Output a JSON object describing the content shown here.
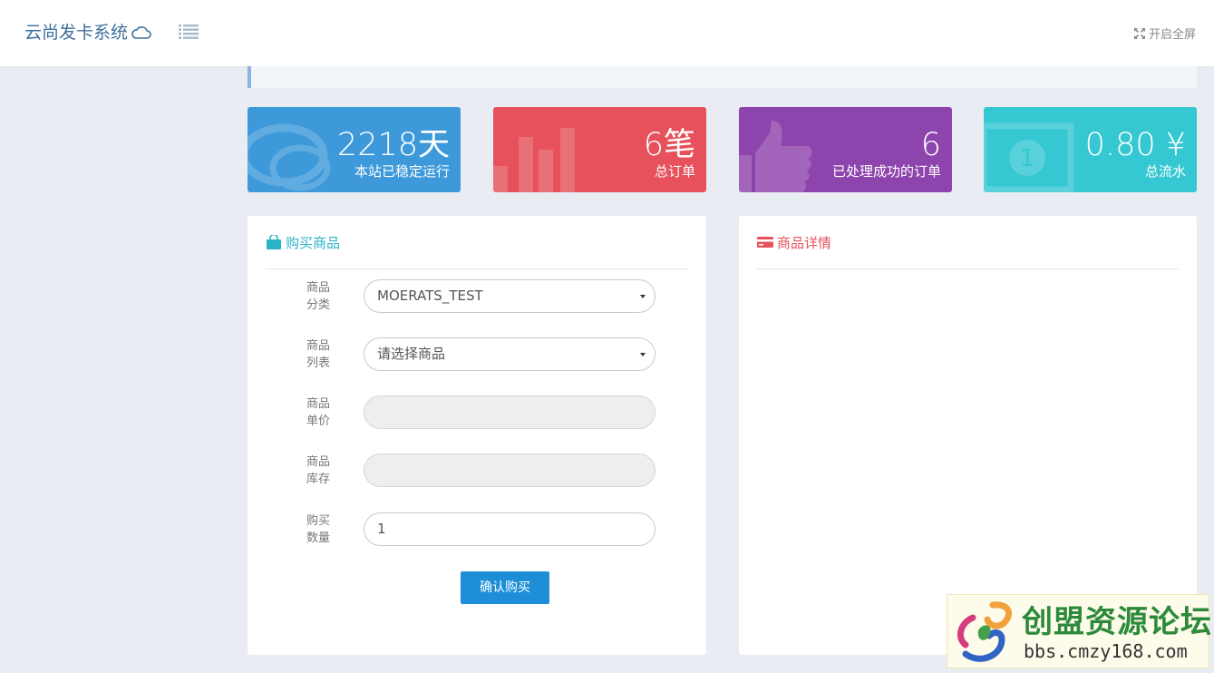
{
  "header": {
    "brand": "云尚发卡系统",
    "brand_icon": "cloud-icon",
    "menu_icon": "list-icon",
    "fullscreen_label": "开启全屏",
    "fullscreen_icon": "expand-icon"
  },
  "stats": [
    {
      "value": "2218天",
      "label": "本站已稳定运行",
      "color": "#3d99d9",
      "icon": "chat-bubble-icon"
    },
    {
      "value": "6笔",
      "label": "总订单",
      "color": "#e6515b",
      "icon": "bar-chart-icon"
    },
    {
      "value": "6",
      "label": "已处理成功的订单",
      "color": "#8e44ad",
      "icon": "thumbs-up-icon"
    },
    {
      "value": "0.80 ¥",
      "label": "总流水",
      "color": "#35c7d2",
      "icon": "money-icon"
    }
  ],
  "buy_panel": {
    "title": "购买商品",
    "title_icon": "shopping-bag-icon",
    "title_color": "#2bb3c8",
    "fields": {
      "category": {
        "label_line1": "商品",
        "label_line2": "分类",
        "value": "MOERATS_TEST"
      },
      "product": {
        "label_line1": "商品",
        "label_line2": "列表",
        "value": "请选择商品"
      },
      "price": {
        "label_line1": "商品",
        "label_line2": "单价",
        "value": ""
      },
      "stock": {
        "label_line1": "商品",
        "label_line2": "库存",
        "value": ""
      },
      "quantity": {
        "label_line1": "购买",
        "label_line2": "数量",
        "value": "1"
      }
    },
    "submit_label": "确认购买",
    "submit_color": "#1e8ed8"
  },
  "detail_panel": {
    "title": "商品详情",
    "title_icon": "credit-card-icon",
    "title_color": "#e6515b"
  },
  "watermark": {
    "title": "创盟资源论坛",
    "url": "bbs.cmzy168.com",
    "icon": "forum-logo-icon"
  }
}
